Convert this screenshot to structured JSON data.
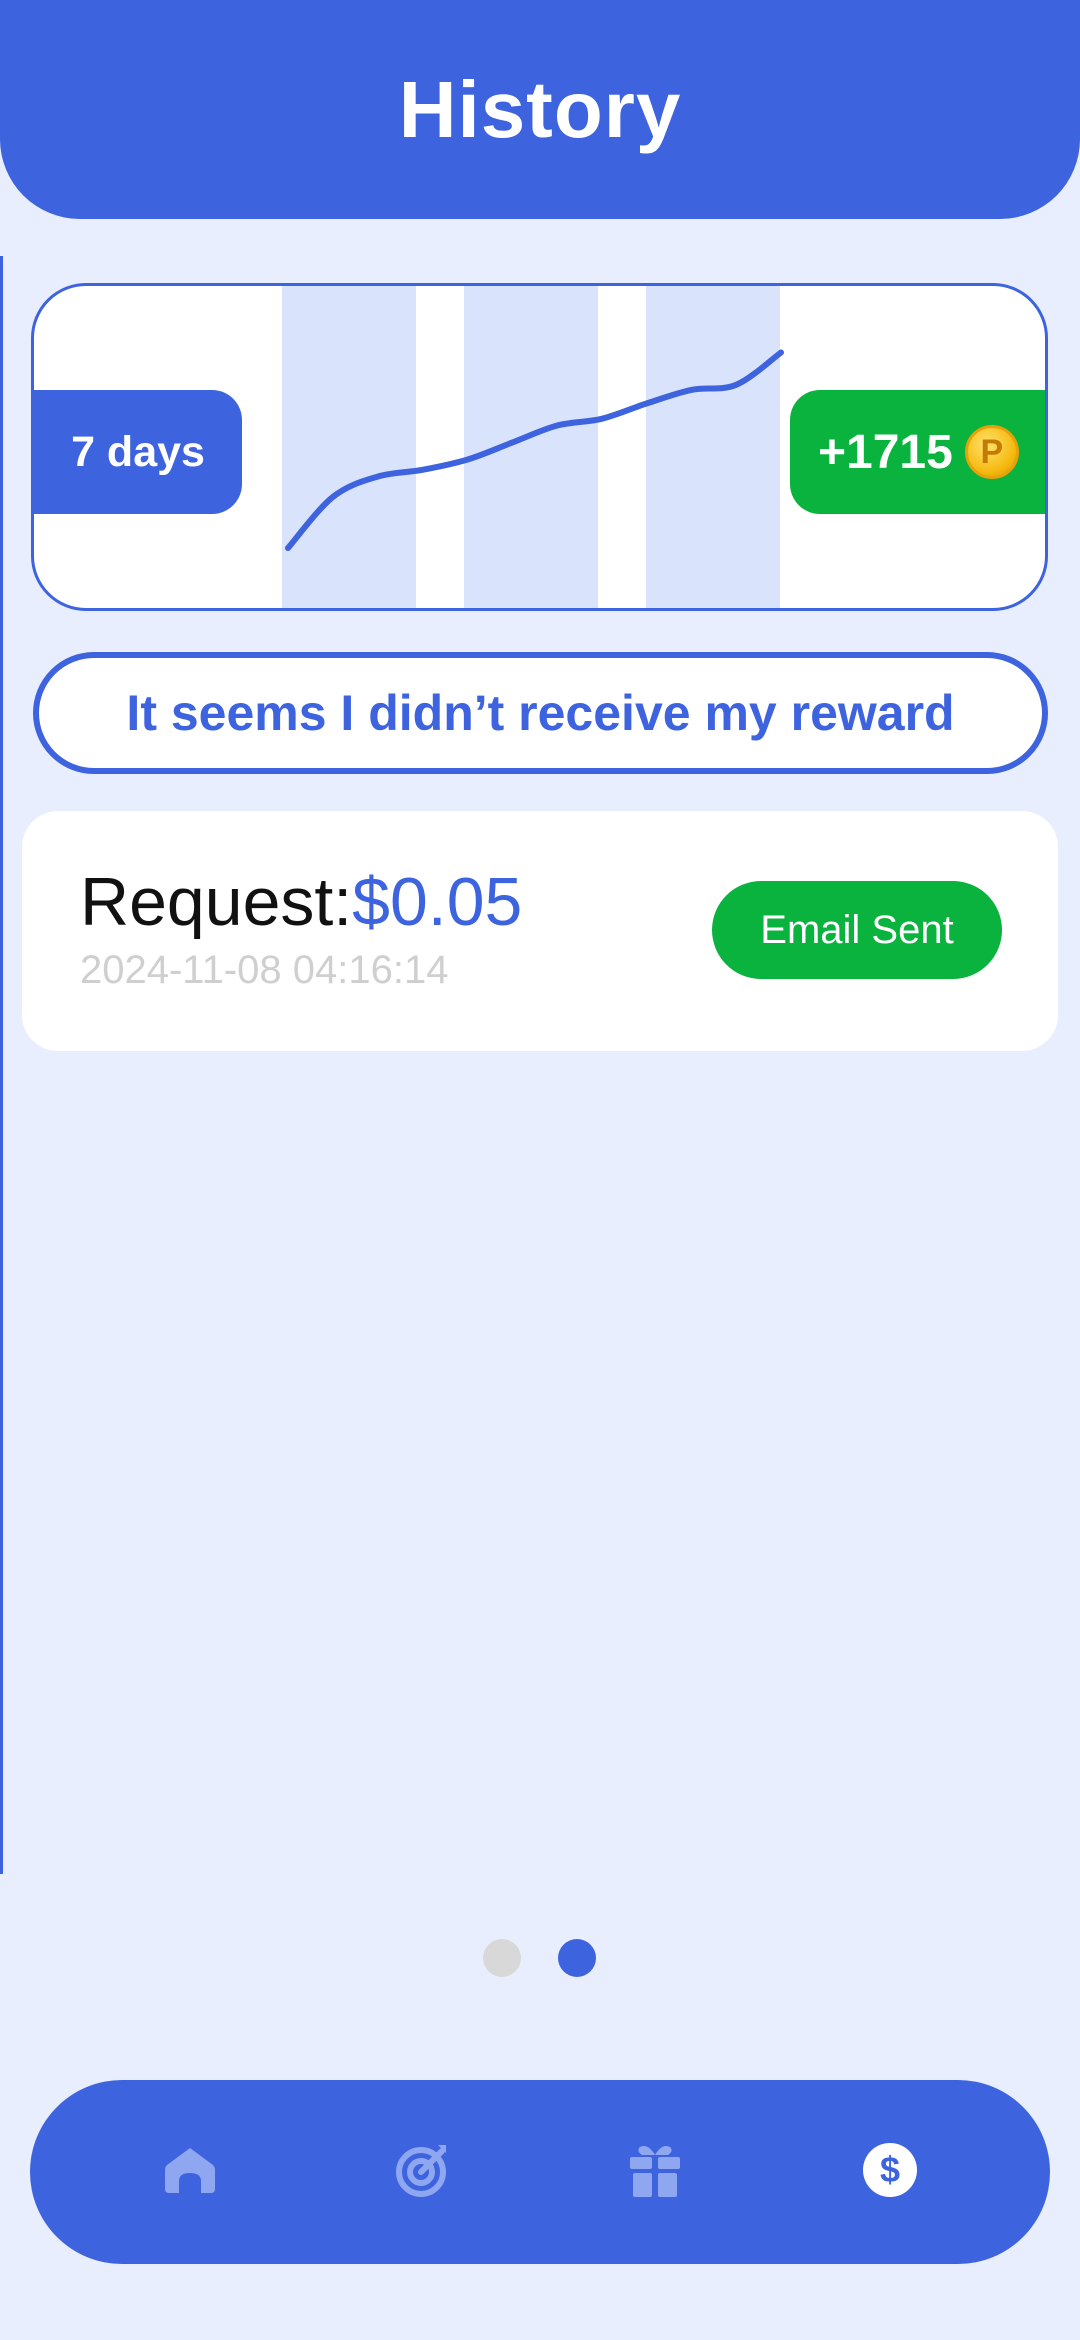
{
  "header": {
    "title": "History"
  },
  "summary": {
    "period_label": "7 days",
    "points_label": "+1715",
    "coin_icon": "coin-icon",
    "coin_symbol": "P"
  },
  "chart_data": {
    "type": "line",
    "title": "",
    "xlabel": "",
    "ylabel": "",
    "series": [
      {
        "values": [
          0,
          30,
          42,
          46,
          52,
          62,
          72,
          76,
          85,
          93,
          96,
          115
        ]
      }
    ],
    "ylim": [
      0,
      120
    ],
    "grid": false
  },
  "reward_button": {
    "label": "It seems I didn’t receive my reward"
  },
  "request": {
    "label": "Request:",
    "amount": "$0.05",
    "date": "2024-11-08 04:16:14",
    "status": "Email Sent"
  },
  "pager": {
    "active_index": 1,
    "count": 2
  },
  "nav": {
    "items": [
      {
        "icon": "home-icon"
      },
      {
        "icon": "target-icon"
      },
      {
        "icon": "gift-icon"
      },
      {
        "icon": "dollar-icon"
      }
    ],
    "active_index": 3
  },
  "colors": {
    "primary": "#3d63df",
    "success": "#09b33d",
    "background": "#e8eefd"
  }
}
